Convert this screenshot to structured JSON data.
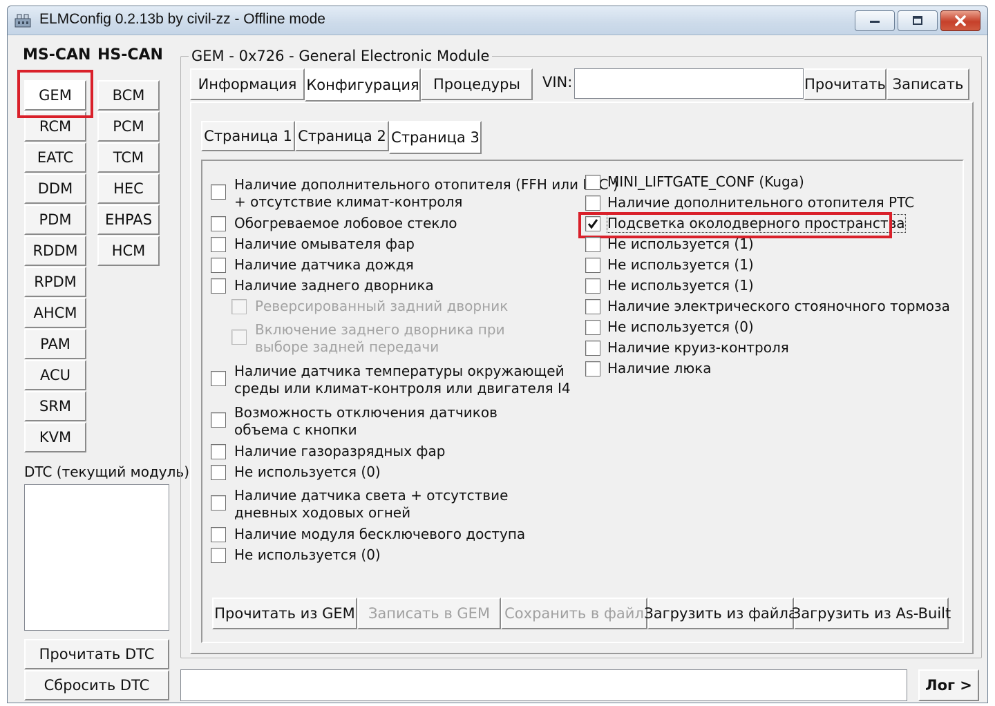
{
  "window": {
    "title": "ELMConfig 0.2.13b by civil-zz - Offline mode",
    "icon": "app-icon"
  },
  "left": {
    "ms_can_label": "MS-CAN",
    "hs_can_label": "HS-CAN",
    "ms_modules": [
      "GEM",
      "RCM",
      "EATC",
      "DDM",
      "PDM",
      "RDDM",
      "RPDM",
      "AHCM",
      "PAM",
      "ACU",
      "SRM",
      "KVM"
    ],
    "hs_modules": [
      "BCM",
      "PCM",
      "TCM",
      "HEC",
      "EHPAS",
      "HCM"
    ],
    "selected_module": "GEM",
    "dtc_label": "DTC (текущий модуль):",
    "read_dtc": "Прочитать DTC",
    "reset_dtc": "Сбросить DTC"
  },
  "module": {
    "group_title": "GEM - 0x726 - General Electronic Module",
    "tabs": [
      "Информация",
      "Конфигурация",
      "Процедуры"
    ],
    "active_tab": "Конфигурация",
    "vin_label": "VIN:",
    "vin_value": "",
    "read_button": "Прочитать",
    "write_button": "Записать",
    "pages": [
      "Страница 1",
      "Страница 2",
      "Страница 3"
    ],
    "active_page": "Страница 3"
  },
  "options_left": [
    {
      "line1": "Наличие дополнительного отопителя (FFH или PTC )",
      "line2": "+ отсутствие климат-контроля",
      "checked": false,
      "enabled": true
    },
    {
      "line1": "Обогреваемое лобовое стекло",
      "line2": "",
      "checked": false,
      "enabled": true
    },
    {
      "line1": "Наличие омывателя фар",
      "line2": "",
      "checked": false,
      "enabled": true
    },
    {
      "line1": "Наличие датчика дождя",
      "line2": "",
      "checked": false,
      "enabled": true
    },
    {
      "line1": "Наличие заднего дворника",
      "line2": "",
      "checked": false,
      "enabled": true
    },
    {
      "line1": "Реверсированный задний дворник",
      "line2": "",
      "checked": false,
      "enabled": false
    },
    {
      "line1": "Включение заднего дворника при",
      "line2": "выборе задней передачи",
      "checked": false,
      "enabled": false
    },
    {
      "line1": "Наличие датчика температуры окружающей",
      "line2": "среды или климат-контроля или двигателя I4",
      "checked": false,
      "enabled": true
    },
    {
      "line1": "Возможность отключения датчиков",
      "line2": "объема с кнопки",
      "checked": false,
      "enabled": true
    },
    {
      "line1": "Наличие газоразрядных фар",
      "line2": "",
      "checked": false,
      "enabled": true
    },
    {
      "line1": "Не используется (0)",
      "line2": "",
      "checked": false,
      "enabled": true
    },
    {
      "line1": "Наличие датчика света + отсутствие",
      "line2": "дневных ходовых огней",
      "checked": false,
      "enabled": true
    },
    {
      "line1": "Наличие модуля бесключевого доступа",
      "line2": "",
      "checked": false,
      "enabled": true
    },
    {
      "line1": "Не используется (0)",
      "line2": "",
      "checked": false,
      "enabled": true
    }
  ],
  "options_right": [
    {
      "line1": "MINI_LIFTGATE_CONF (Kuga)",
      "checked": false
    },
    {
      "line1": "Наличие дополнительного отопителя PTC",
      "checked": false
    },
    {
      "line1": "Подсветка околодверного пространства",
      "checked": true
    },
    {
      "line1": "Не используется (1)",
      "checked": false
    },
    {
      "line1": "Не используется (1)",
      "checked": false
    },
    {
      "line1": "Не используется (1)",
      "checked": false
    },
    {
      "line1": "Наличие электрического стояночного тормоза",
      "checked": false
    },
    {
      "line1": "Не используется (0)",
      "checked": false
    },
    {
      "line1": "Наличие круиз-контроля",
      "checked": false
    },
    {
      "line1": "Наличие люка",
      "checked": false
    }
  ],
  "bottom_buttons": [
    {
      "label": "Прочитать из GEM",
      "enabled": true
    },
    {
      "label": "Записать в GEM",
      "enabled": false
    },
    {
      "label": "Сохранить в файл",
      "enabled": false
    },
    {
      "label": "Загрузить из файла",
      "enabled": true
    },
    {
      "label": "Загрузить из As-Built",
      "enabled": true
    }
  ],
  "log_button": "Лог >",
  "status_text": "",
  "highlight_color": "#d9202a"
}
